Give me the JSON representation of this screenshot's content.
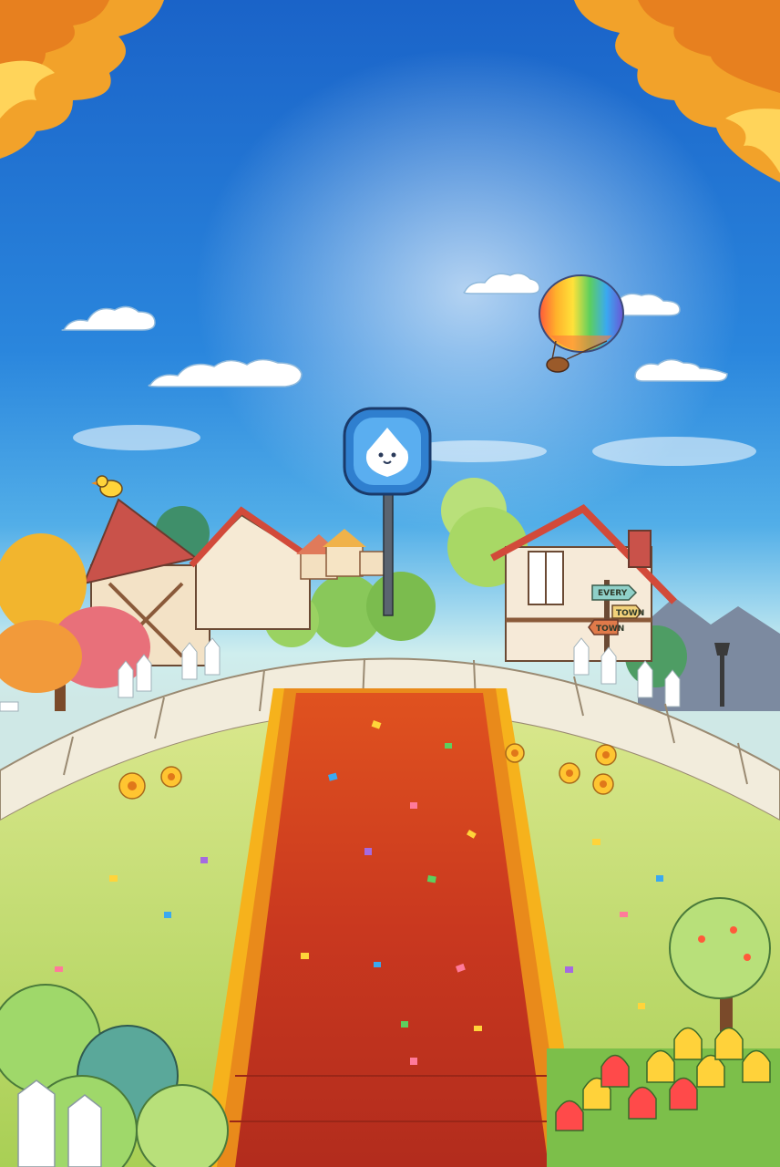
{
  "scene": {
    "title": "",
    "sky_colors": {
      "top": "#1a63c8",
      "horizon": "#cfeeee"
    },
    "carpet_color": "#c53a22",
    "carpet_trim_color": "#f6b21c"
  },
  "signpost": {
    "icon": "blue-droplet-mascot-icon",
    "arrows": [
      {
        "label": "EVERY"
      },
      {
        "label": "TOWN"
      },
      {
        "label": "TOWN"
      }
    ]
  },
  "decorations": {
    "balloon": "hot-air-balloon",
    "bird": "yellow-bird",
    "flowers": "yellow-flowers",
    "tulips": "tulip-bed"
  }
}
